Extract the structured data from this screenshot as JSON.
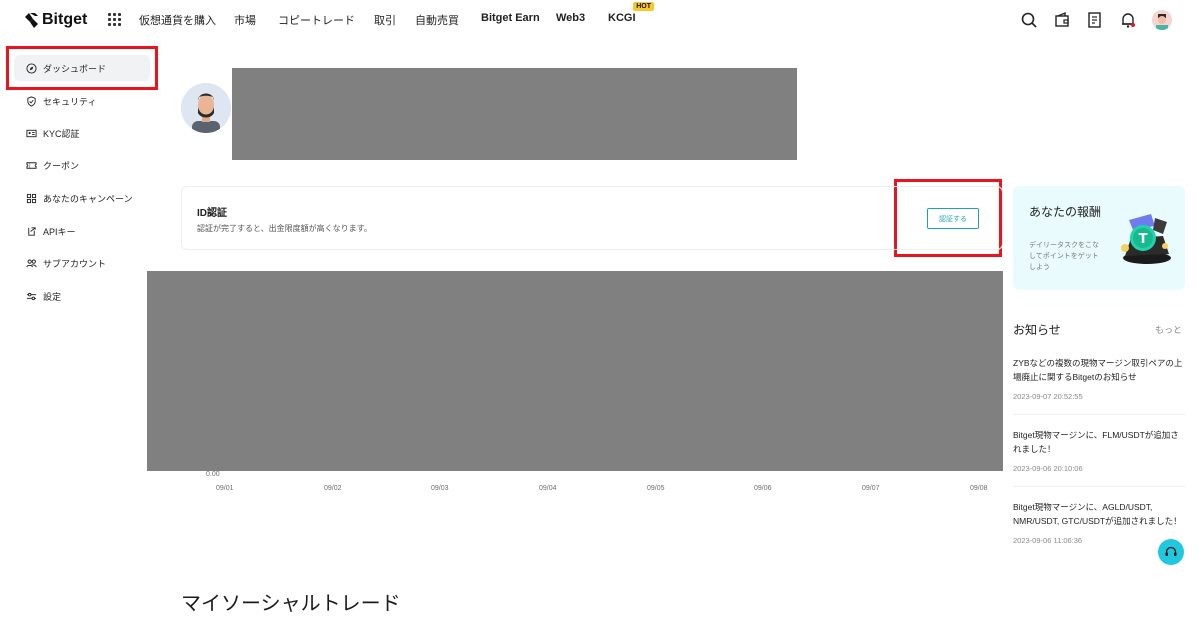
{
  "header": {
    "brand": "Bitget",
    "nav": [
      {
        "label": "仮想通貨を購入"
      },
      {
        "label": "市場"
      },
      {
        "label": "コピートレード"
      },
      {
        "label": "取引"
      },
      {
        "label": "自動売買"
      },
      {
        "label": "Bitget Earn"
      },
      {
        "label": "Web3"
      },
      {
        "label": "KCGI",
        "badge": "HOT"
      }
    ],
    "icons": [
      "search-icon",
      "wallet-icon",
      "orders-icon",
      "bell-icon",
      "user-avatar"
    ]
  },
  "sidebar": {
    "items": [
      {
        "label": "ダッシュボード",
        "icon": "compass-icon",
        "active": true
      },
      {
        "label": "セキュリティ",
        "icon": "shield-icon"
      },
      {
        "label": "KYC認証",
        "icon": "id-card-icon"
      },
      {
        "label": "クーポン",
        "icon": "ticket-icon"
      },
      {
        "label": "あなたのキャンペーン",
        "icon": "grid-icon"
      },
      {
        "label": "APIキー",
        "icon": "api-icon"
      },
      {
        "label": "サブアカウント",
        "icon": "users-icon"
      },
      {
        "label": "設定",
        "icon": "sliders-icon"
      }
    ]
  },
  "id_verification": {
    "title": "ID認証",
    "description": "認証が完了すると、出金限度額が高くなります。",
    "button": "認証する"
  },
  "chart": {
    "y_zero": "0.00",
    "x_labels": [
      "09/01",
      "09/02",
      "09/03",
      "09/04",
      "09/05",
      "09/06",
      "09/07",
      "09/08"
    ]
  },
  "social_section_title": "マイソーシャルトレード",
  "reward": {
    "title": "あなたの報酬",
    "subtitle": "デイリータスクをこなしてポイントをゲットしよう"
  },
  "news": {
    "heading": "お知らせ",
    "more": "もっと",
    "items": [
      {
        "title": "ZYBなどの複数の現物マージン取引ペアの上場廃止に関するBitgetのお知らせ",
        "date": "2023-09-07 20:52:55"
      },
      {
        "title": "Bitget現物マージンに、FLM/USDTが追加されました！",
        "date": "2023-09-06 20:10:06"
      },
      {
        "title": "Bitget現物マージンに、AGLD/USDT, NMR/USDT, GTC/USDTが追加されました！",
        "date": "2023-09-06 11:06:36"
      }
    ]
  },
  "colors": {
    "accent": "#1da2b4",
    "highlight": "#e8141e",
    "masked": "#7f807f"
  }
}
